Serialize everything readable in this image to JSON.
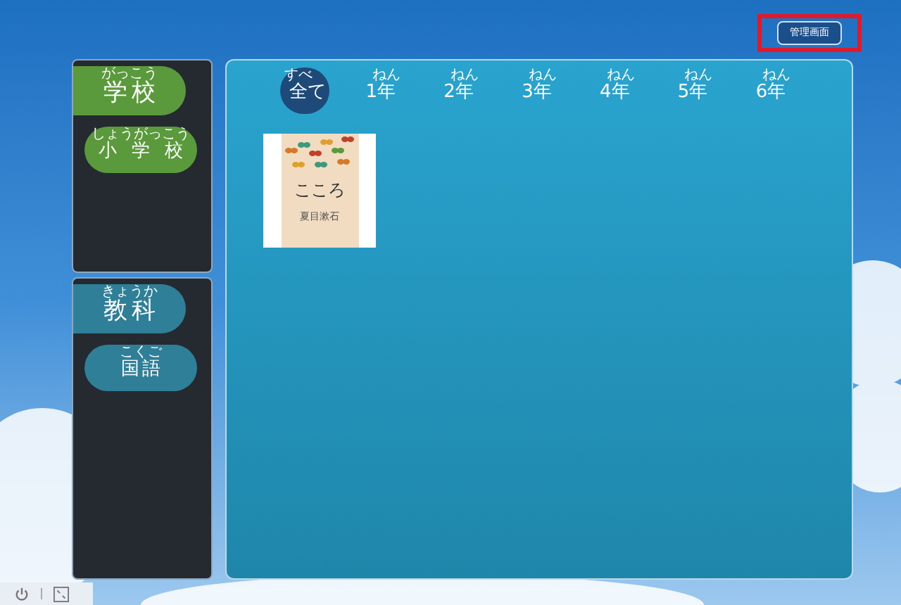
{
  "admin_button": {
    "label": "管理画面",
    "highlighted": true
  },
  "school_panel": {
    "header": {
      "parts": [
        {
          "text": "学校",
          "ruby": "がっこう"
        }
      ]
    },
    "items": [
      {
        "parts": [
          {
            "text": "小学校",
            "ruby": "しょうがっこう"
          }
        ],
        "selected": false
      }
    ]
  },
  "subject_panel": {
    "header": {
      "parts": [
        {
          "text": "教科",
          "ruby": "きょうか"
        }
      ]
    },
    "items": [
      {
        "parts": [
          {
            "text": "国語",
            "ruby": "こくご"
          }
        ],
        "selected": false
      }
    ]
  },
  "grade_tabs": [
    {
      "parts": [
        {
          "text": "全",
          "ruby": "すべ"
        },
        {
          "text": "て"
        }
      ],
      "selected": true
    },
    {
      "parts": [
        {
          "text": "1"
        },
        {
          "text": "年",
          "ruby": "ねん"
        }
      ],
      "selected": false
    },
    {
      "parts": [
        {
          "text": "2"
        },
        {
          "text": "年",
          "ruby": "ねん"
        }
      ],
      "selected": false
    },
    {
      "parts": [
        {
          "text": "3"
        },
        {
          "text": "年",
          "ruby": "ねん"
        }
      ],
      "selected": false
    },
    {
      "parts": [
        {
          "text": "4"
        },
        {
          "text": "年",
          "ruby": "ねん"
        }
      ],
      "selected": false
    },
    {
      "parts": [
        {
          "text": "5"
        },
        {
          "text": "年",
          "ruby": "ねん"
        }
      ],
      "selected": false
    },
    {
      "parts": [
        {
          "text": "6"
        },
        {
          "text": "年",
          "ruby": "ねん"
        }
      ],
      "selected": false
    }
  ],
  "books": [
    {
      "title": "こころ",
      "author": "夏目漱石"
    }
  ]
}
